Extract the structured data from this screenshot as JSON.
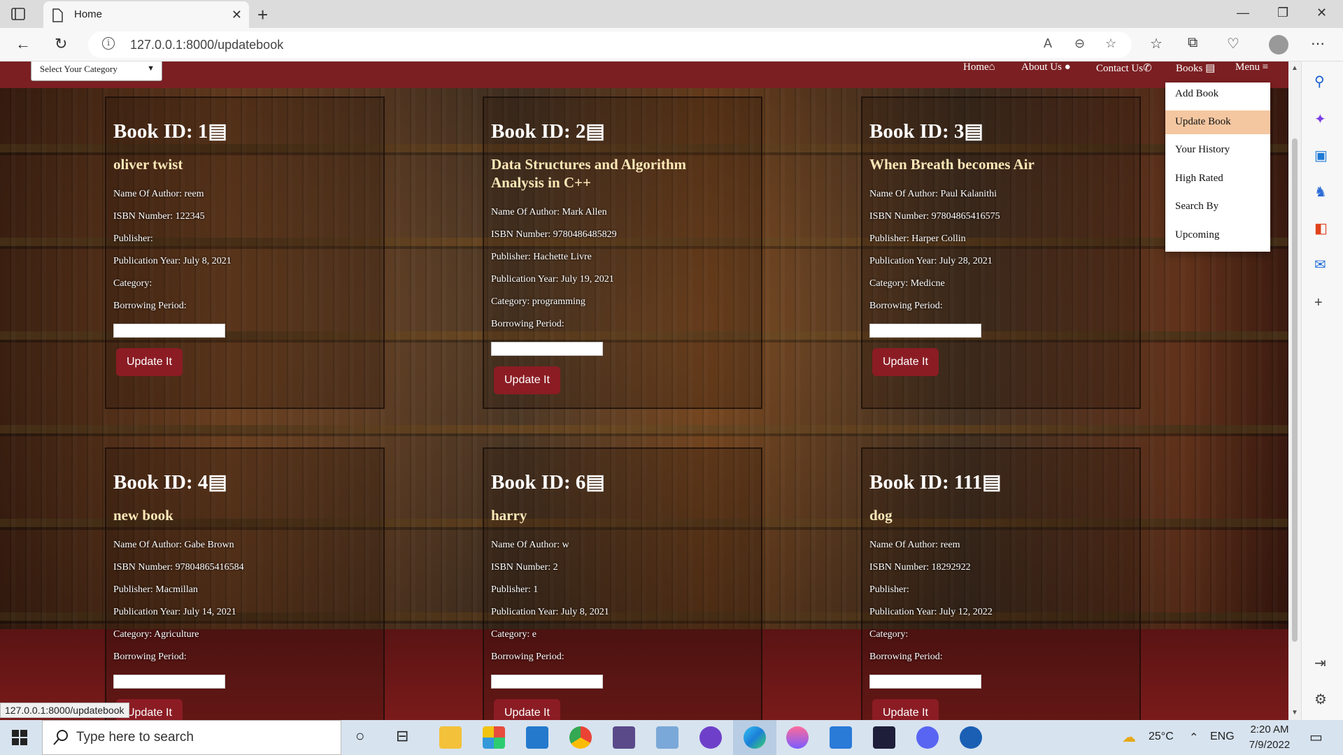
{
  "browser": {
    "tab_title": "Home",
    "url": "127.0.0.1:8000/updatebook"
  },
  "site": {
    "category_select": "Select Your Category",
    "nav": {
      "home": "Home",
      "about": "About Us",
      "contact": "Contact Us",
      "books": "Books",
      "menu": "Menu"
    },
    "dropdown": [
      "Add Book",
      "Update Book",
      "Your History",
      "High Rated",
      "Search By",
      "Upcoming"
    ]
  },
  "labels": {
    "author": "Name Of Author:",
    "isbn": "ISBN Number:",
    "publisher": "Publisher:",
    "year": "Publication Year:",
    "category": "Category:",
    "borrowing": "Borrowing Period:",
    "button": "Update It"
  },
  "books": [
    {
      "id": "Book ID: 1",
      "title": "oliver twist",
      "author": "reem",
      "isbn": "122345",
      "publisher": "",
      "year": "July 8, 2021",
      "category": ""
    },
    {
      "id": "Book ID: 2",
      "title": "Data Structures and Algorithm Analysis in C++",
      "author": "Mark Allen",
      "isbn": "9780486485829",
      "publisher": "Hachette Livre",
      "year": "July 19, 2021",
      "category": "programming"
    },
    {
      "id": "Book ID: 3",
      "title": "When Breath becomes Air",
      "author": "Paul Kalanithi",
      "isbn": "97804865416575",
      "publisher": "Harper Collin",
      "year": "July 28, 2021",
      "category": "Medicne"
    },
    {
      "id": "Book ID: 4",
      "title": "new book",
      "author": "Gabe Brown",
      "isbn": "97804865416584",
      "publisher": "Macmillan",
      "year": "July 14, 2021",
      "category": "Agriculture"
    },
    {
      "id": "Book ID: 6",
      "title": "harry",
      "author": "w",
      "isbn": "2",
      "publisher": "1",
      "year": "July 8, 2021",
      "category": "e"
    },
    {
      "id": "Book ID: 111",
      "title": "dog",
      "author": "reem",
      "isbn": "18292922",
      "publisher": "",
      "year": "July 12, 2022",
      "category": ""
    }
  ],
  "status_tip": "127.0.0.1:8000/updatebook",
  "taskbar": {
    "search_placeholder": "Type here to search",
    "weather": "25°C",
    "lang": "ENG",
    "time": "2:20 AM",
    "date": "7/9/2022"
  }
}
